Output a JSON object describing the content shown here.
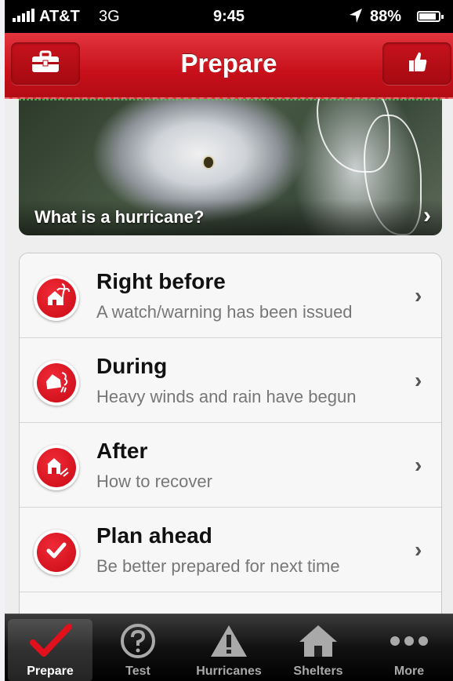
{
  "status_bar": {
    "carrier": "AT&T",
    "network": "3G",
    "time": "9:45",
    "battery": "88%",
    "battery_level": 0.88
  },
  "nav": {
    "title": "Prepare",
    "left_icon": "toolbox-icon",
    "right_icon": "thumbs-up-icon"
  },
  "hero": {
    "caption": "What is a hurricane?"
  },
  "list": [
    {
      "title": "Right before",
      "subtitle": "A watch/warning has been issued",
      "icon": "house-palm-icon"
    },
    {
      "title": "During",
      "subtitle": "Heavy winds and rain have begun",
      "icon": "house-storm-icon"
    },
    {
      "title": "After",
      "subtitle": "How to recover",
      "icon": "house-recover-icon"
    },
    {
      "title": "Plan ahead",
      "subtitle": "Be better prepared for next time",
      "icon": "checkmark-icon"
    }
  ],
  "tabs": [
    {
      "label": "Prepare",
      "icon": "checkmark-icon",
      "active": true
    },
    {
      "label": "Test",
      "icon": "question-icon",
      "active": false
    },
    {
      "label": "Hurricanes",
      "icon": "warning-icon",
      "active": false
    },
    {
      "label": "Shelters",
      "icon": "house-icon",
      "active": false
    },
    {
      "label": "More",
      "icon": "more-dots-icon",
      "active": false
    }
  ],
  "colors": {
    "brand_red": "#d01420",
    "tab_bar": "#111111",
    "list_bg": "#f7f7f7"
  }
}
